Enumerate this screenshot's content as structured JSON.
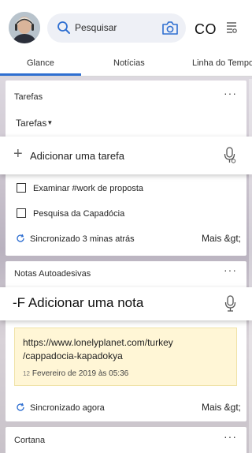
{
  "header": {
    "search_placeholder": "Pesquisar",
    "co_label": "CO"
  },
  "tabs": [
    {
      "label": "Glance",
      "active": true
    },
    {
      "label": "Notícias",
      "active": false
    },
    {
      "label": "Linha do Tempo",
      "active": false
    }
  ],
  "tasks_card": {
    "title": "Tarefas",
    "more": "···",
    "list_selector": "Tarefas",
    "add_task_label": "Adicionar uma tarefa",
    "items": [
      {
        "text": "Examinar #work de proposta",
        "checked": false
      },
      {
        "text": "Pesquisa da Capadócia",
        "checked": false
      }
    ],
    "sync_status": "Sincronizado 3 minas atrás",
    "more_link": "Mais &gt;"
  },
  "notes_card": {
    "title": "Notas Autoadesivas",
    "more": "···",
    "add_note_label": "-F Adicionar uma nota",
    "note": {
      "url_line1": "https://www.lonelyplanet.com/turkey",
      "url_line2": "/cappadocia-kapadokya",
      "date_icon": "12",
      "date": "Fevereiro de 2019 às 05:36"
    },
    "sync_status": "Sincronizado agora",
    "more_link": "Mais &gt;"
  },
  "cortana_card": {
    "title": "Cortana",
    "more": "···"
  },
  "colors": {
    "accent": "#2f6fd1",
    "sticky_bg": "#fff6d6"
  }
}
